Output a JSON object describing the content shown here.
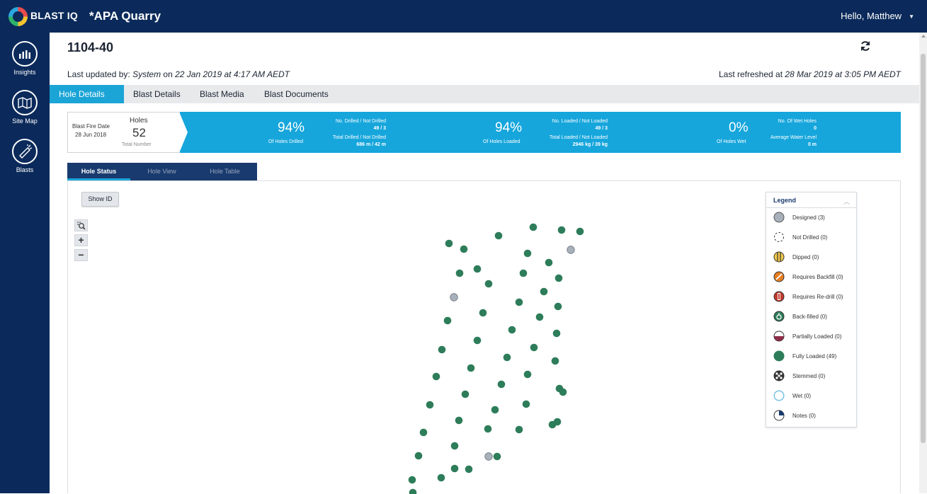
{
  "app": {
    "logo_text": "BLAST IQ",
    "site_title": "*APA Quarry",
    "greeting": "Hello, Matthew"
  },
  "sidebar": {
    "items": [
      {
        "label": "Insights",
        "icon": "bar-chart-icon"
      },
      {
        "label": "Site Map",
        "icon": "map-icon"
      },
      {
        "label": "Blasts",
        "icon": "blast-icon"
      }
    ]
  },
  "blast": {
    "id": "1104-40",
    "updated_prefix": "Last updated by: ",
    "updated_by": "System",
    "updated_on": " on ",
    "updated_date": "22 Jan 2019 at 4:17 AM AEDT",
    "refreshed_prefix": "Last refreshed at ",
    "refreshed_date": "28 Mar 2019 at 3:05 PM AEDT"
  },
  "tabs": [
    "Hole Details",
    "Blast Details",
    "Blast Media",
    "Blast Documents"
  ],
  "summary": {
    "fire_date_label": "Blast Fire Date",
    "fire_date": "28 Jun 2018",
    "holes_label": "Holes",
    "holes_count": "52",
    "holes_sub": "Total Number",
    "drilled_pct": "94%",
    "drilled_label": "Of Holes Drilled",
    "drilled_count_label": "No. Drilled / Not Drilled",
    "drilled_count": "49 / 3",
    "drilled_total_label": "Total Drilled / Not Drilled",
    "drilled_total": "686 m / 42 m",
    "loaded_pct": "94%",
    "loaded_label": "Of Holes Loaded",
    "loaded_count_label": "No. Loaded / Not Loaded",
    "loaded_count": "49 / 3",
    "loaded_total_label": "Total Loaded / Not Loaded",
    "loaded_total": "2946 kg / 39 kg",
    "wet_pct": "0%",
    "wet_label": "Of Holes Wet",
    "wet_count_label": "No. Of Wet Holes",
    "wet_count": "0",
    "water_label": "Average Water Level",
    "water_value": "0 m"
  },
  "subtabs": [
    "Hole Status",
    "Hole View",
    "Hole Table"
  ],
  "map": {
    "show_id_label": "Show ID",
    "zoom_in": "+",
    "zoom_out": "−"
  },
  "legend": {
    "title": "Legend",
    "items": [
      {
        "label": "Designed (3)",
        "icon": "designed-icon"
      },
      {
        "label": "Not Drilled (0)",
        "icon": "not-drilled-icon"
      },
      {
        "label": "Dipped (0)",
        "icon": "dipped-icon"
      },
      {
        "label": "Requires Backfill (0)",
        "icon": "requires-backfill-icon"
      },
      {
        "label": "Requires Re-drill (0)",
        "icon": "requires-redrill-icon"
      },
      {
        "label": "Back-filled (0)",
        "icon": "back-filled-icon"
      },
      {
        "label": "Partially Loaded (0)",
        "icon": "partially-loaded-icon"
      },
      {
        "label": "Fully Loaded (49)",
        "icon": "fully-loaded-icon"
      },
      {
        "label": "Stemmed (0)",
        "icon": "stemmed-icon"
      },
      {
        "label": "Wet (0)",
        "icon": "wet-icon"
      },
      {
        "label": "Notes (0)",
        "icon": "notes-icon"
      }
    ]
  },
  "colors": {
    "header": "#0b2a5b",
    "accent": "#16a6dc",
    "fully_loaded": "#2e7d5a",
    "designed": "#a8b0ba"
  }
}
